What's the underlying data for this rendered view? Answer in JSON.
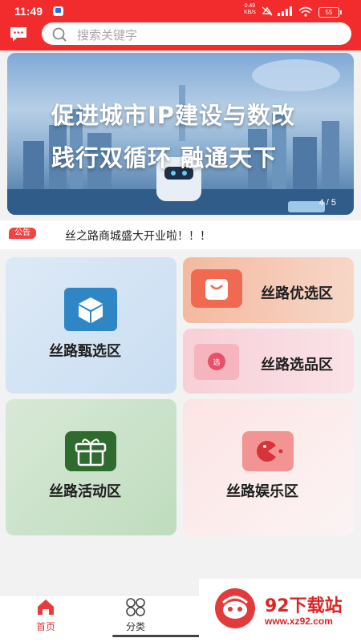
{
  "status_bar": {
    "time": "11:49",
    "net_speed_value": "0.49",
    "net_speed_unit": "KB/s",
    "network": "5G",
    "battery": "55"
  },
  "header": {
    "search_placeholder": "搜索关键字",
    "message_icon": "chat-bubble-icon",
    "search_icon": "search-icon"
  },
  "banner": {
    "line1": "促进城市IP建设与数改",
    "line2": "践行双循环 融通天下",
    "pager": "4 / 5"
  },
  "notice": {
    "tag": "公告",
    "text": "丝之路商城盛大开业啦！！！"
  },
  "categories": [
    {
      "label": "丝路甄选区",
      "icon": "cube-icon"
    },
    {
      "label": "丝路优选区",
      "icon": "shopping-bag-icon"
    },
    {
      "label": "丝路选品区",
      "icon": "select-badge-icon",
      "badge": "选"
    },
    {
      "label": "丝路活动区",
      "icon": "gift-icon"
    },
    {
      "label": "丝路娱乐区",
      "icon": "game-icon"
    }
  ],
  "tabbar": {
    "tabs": [
      {
        "label": "首页",
        "icon": "home-icon",
        "active": true
      },
      {
        "label": "分类",
        "icon": "category-icon",
        "active": false
      }
    ]
  },
  "watermark": {
    "title": "92下载站",
    "url": "www.xz92.com"
  },
  "colors": {
    "brand_red": "#f22c2c",
    "active_tab": "#e83a3a"
  }
}
